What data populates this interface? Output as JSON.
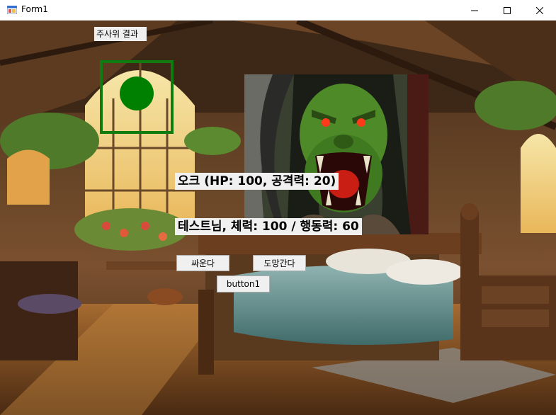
{
  "window": {
    "title": "Form1"
  },
  "labels": {
    "dice_result": "주사위 결과",
    "enemy_status": "오크 (HP: 100, 공격력: 20)",
    "player_status": "테스트님, 체력: 100 / 행동력: 60"
  },
  "buttons": {
    "fight": "싸운다",
    "flee": "도망간다",
    "button1": "button1"
  },
  "colors": {
    "dice_box": "#107c10",
    "dice_circle": "#008000",
    "label_bg": "#f0f0f0"
  },
  "icons": [
    "app-icon",
    "minimize-icon",
    "maximize-icon",
    "close-icon",
    "dice-circle-icon"
  ]
}
